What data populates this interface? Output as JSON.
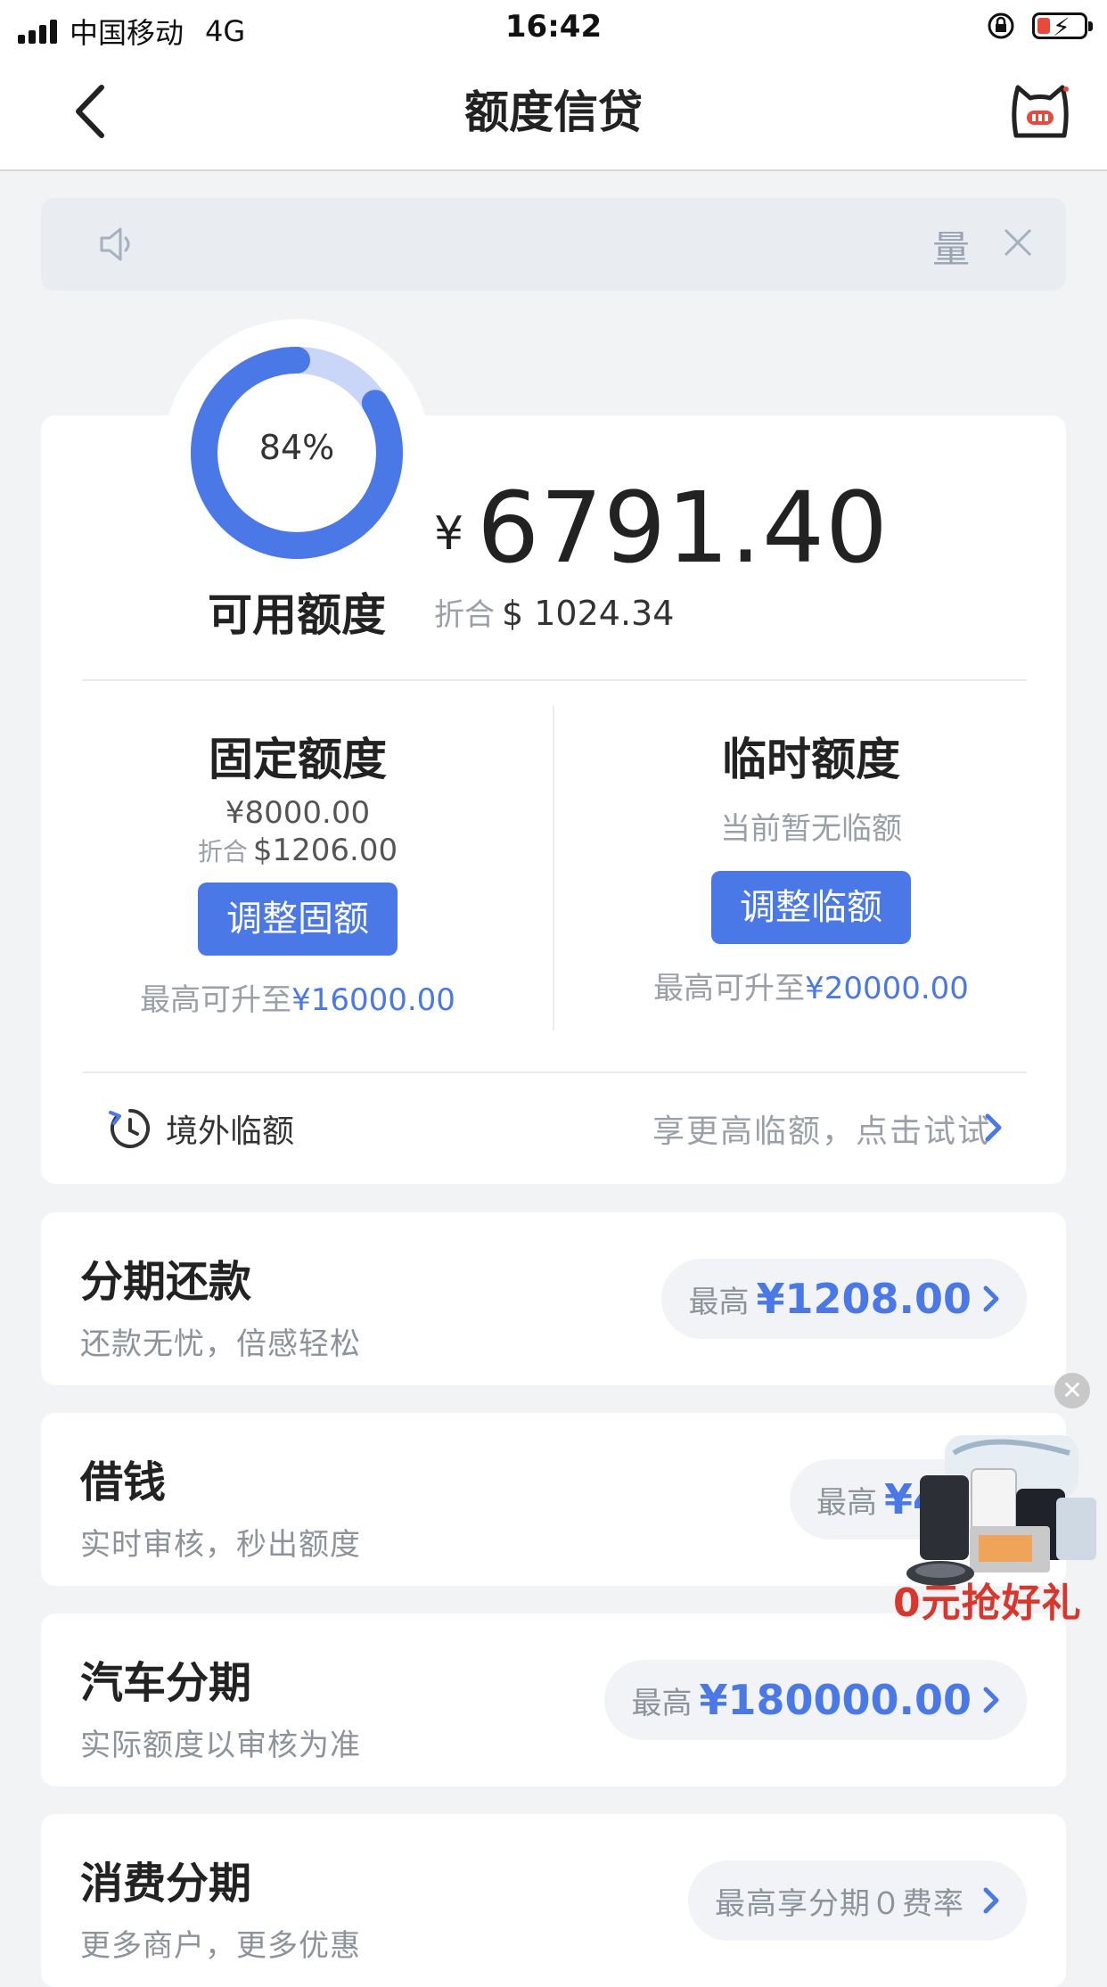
{
  "status_bar": {
    "carrier": "中国移动",
    "network": "4G",
    "time": "16:42"
  },
  "nav": {
    "title": "额度信贷"
  },
  "notice": {
    "text": "量"
  },
  "credit": {
    "ring_percent_label": "84%",
    "ring_percent": 0.84,
    "available_label": "可用额度",
    "currency_symbol": "¥",
    "available_amount": "6791.40",
    "converted_label": "折合",
    "converted_amount": "$ 1024.34",
    "fixed": {
      "title": "固定额度",
      "amount": "¥8000.00",
      "converted_label": "折合",
      "converted_amount": "$1206.00",
      "button": "调整固额",
      "max_label": "最高可升至",
      "max_value": "¥16000.00"
    },
    "temp": {
      "title": "临时额度",
      "status": "当前暂无临额",
      "button": "调整临额",
      "max_label": "最高可升至",
      "max_value": "¥20000.00"
    },
    "overseas": {
      "label": "境外临额",
      "hint": "享更高临额，点击试试"
    }
  },
  "products": [
    {
      "title": "分期还款",
      "subtitle": "还款无忧，倍感轻松",
      "pill_label": "最高",
      "pill_value": "¥1208.00"
    },
    {
      "title": "借钱",
      "subtitle": "实时审核，秒出额度",
      "pill_label": "最高",
      "pill_value": "¥40"
    },
    {
      "title": "汽车分期",
      "subtitle": "实际额度以审核为准",
      "pill_label": "最高",
      "pill_value": "¥180000.00"
    },
    {
      "title": "消费分期",
      "subtitle": "更多商户，更多优惠",
      "pill_label": "最高享分期０费率",
      "pill_value": ""
    }
  ],
  "promo": {
    "text": "0元抢好礼"
  },
  "colors": {
    "accent": "#4a78e6",
    "ring_track": "#c9d6f7",
    "promo_red": "#d9362e"
  }
}
